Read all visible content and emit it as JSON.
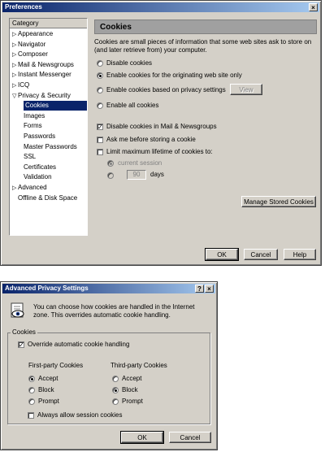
{
  "prefs": {
    "title": "Preferences",
    "close_glyph": "×",
    "category_header": "Category",
    "tree": [
      {
        "label": "Appearance",
        "expander": "▷"
      },
      {
        "label": "Navigator",
        "expander": "▷"
      },
      {
        "label": "Composer",
        "expander": "▷"
      },
      {
        "label": "Mail & Newsgroups",
        "expander": "▷"
      },
      {
        "label": "Instant Messenger",
        "expander": "▷"
      },
      {
        "label": "ICQ",
        "expander": "▷"
      },
      {
        "label": "Privacy & Security",
        "expander": "▽"
      },
      {
        "label": "Cookies",
        "selected": true
      },
      {
        "label": "Images"
      },
      {
        "label": "Forms"
      },
      {
        "label": "Passwords"
      },
      {
        "label": "Master Passwords"
      },
      {
        "label": "SSL"
      },
      {
        "label": "Certificates"
      },
      {
        "label": "Validation"
      },
      {
        "label": "Advanced",
        "expander": "▷"
      },
      {
        "label": "Offline & Disk Space"
      }
    ],
    "panel_title": "Cookies",
    "description": "Cookies are small pieces of information that some web sites ask to store on (and later retrieve from) your computer.",
    "radio_options": [
      {
        "label": "Disable cookies",
        "checked": false
      },
      {
        "label": "Enable cookies for the originating web site only",
        "checked": true
      },
      {
        "label": "Enable cookies based on privacy settings",
        "checked": false
      },
      {
        "label": "Enable all cookies",
        "checked": false
      }
    ],
    "view_button": "View",
    "checkboxes": [
      {
        "label": "Disable cookies in Mail & Newsgroups",
        "checked": true
      },
      {
        "label": "Ask me before storing a cookie",
        "checked": false
      },
      {
        "label": "Limit maximum lifetime of cookies to:",
        "checked": false
      }
    ],
    "lifetime_current": "current session",
    "lifetime_days_value": "90",
    "lifetime_days_label": "days",
    "manage_button": "Manage Stored Cookies",
    "ok_button": "OK",
    "cancel_button": "Cancel",
    "help_button": "Help"
  },
  "adv": {
    "title": "Advanced Privacy Settings",
    "help_glyph": "?",
    "close_glyph": "×",
    "info_text": "You can choose how cookies are handled in the Internet zone. This overrides automatic cookie handling.",
    "group_label": "Cookies",
    "override_label": "Override automatic cookie handling",
    "first_party_title": "First-party Cookies",
    "third_party_title": "Third-party Cookies",
    "first_party": [
      {
        "label": "Accept",
        "checked": true
      },
      {
        "label": "Block",
        "checked": false
      },
      {
        "label": "Prompt",
        "checked": false
      }
    ],
    "third_party": [
      {
        "label": "Accept",
        "checked": false
      },
      {
        "label": "Block",
        "checked": true
      },
      {
        "label": "Prompt",
        "checked": false
      }
    ],
    "session_label": "Always allow session cookies",
    "ok_button": "OK",
    "cancel_button": "Cancel"
  },
  "colors": {
    "titlebar_start": "#0a246a",
    "titlebar_end": "#a6caf0",
    "selection": "#0a246a",
    "face": "#d4d0c8"
  }
}
